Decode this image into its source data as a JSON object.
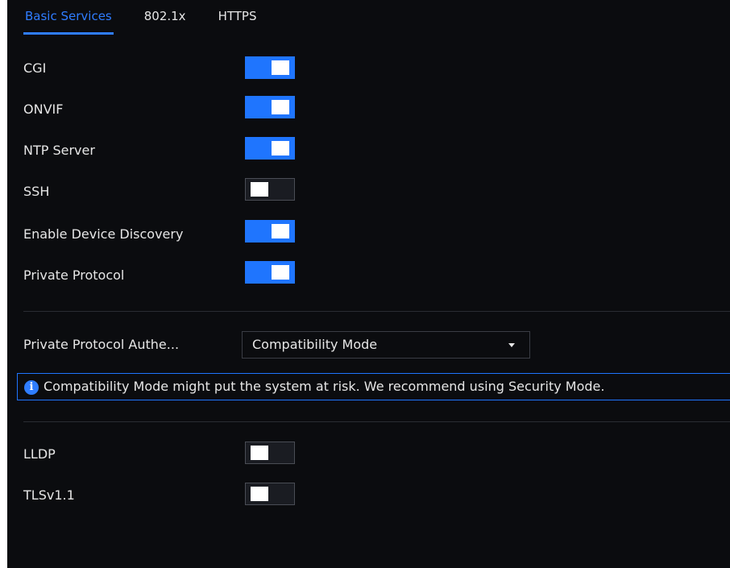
{
  "tabs": [
    {
      "label": "Basic Services",
      "active": true
    },
    {
      "label": "802.1x",
      "active": false
    },
    {
      "label": "HTTPS",
      "active": false
    }
  ],
  "services": {
    "cgi": {
      "label": "CGI",
      "enabled": true
    },
    "onvif": {
      "label": "ONVIF",
      "enabled": true
    },
    "ntp_server": {
      "label": "NTP Server",
      "enabled": true
    },
    "ssh": {
      "label": "SSH",
      "enabled": false
    },
    "device_discovery": {
      "label": "Enable Device Discovery",
      "enabled": true
    },
    "private_protocol": {
      "label": "Private Protocol",
      "enabled": true
    }
  },
  "authentication": {
    "label": "Private Protocol Authe...",
    "selected": "Compatibility Mode"
  },
  "notice": {
    "icon": "info-icon",
    "text": "Compatibility Mode might put the system at risk. We recommend using Security Mode."
  },
  "extra": {
    "lldp": {
      "label": "LLDP",
      "enabled": false
    },
    "tlsv11": {
      "label": "TLSv1.1",
      "enabled": false
    }
  },
  "colors": {
    "accent": "#2f7dff",
    "toggle_on": "#1f75fe",
    "background": "#0b0c0f"
  }
}
